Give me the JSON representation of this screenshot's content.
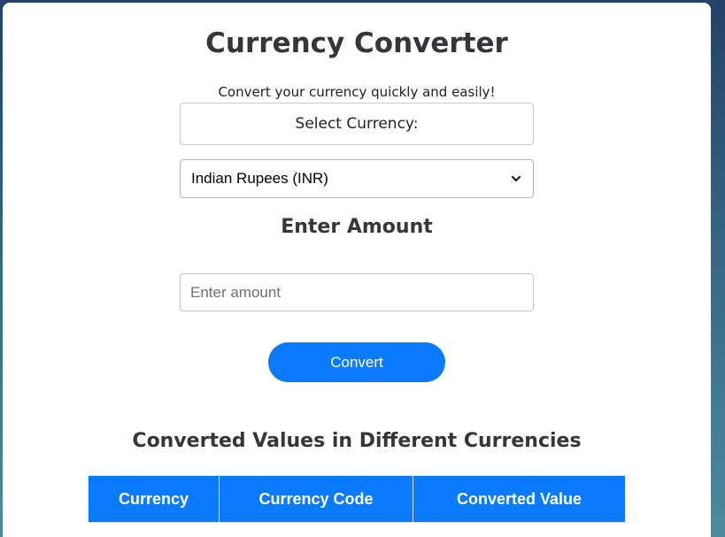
{
  "app": {
    "title": "Currency Converter",
    "subtitle": "Convert your currency quickly and easily!"
  },
  "form": {
    "select_label": "Select Currency:",
    "currency_select": {
      "selected": "Indian Rupees (INR)",
      "icon": "chevron-down-icon"
    },
    "amount_heading": "Enter Amount",
    "amount_input": {
      "value": "",
      "placeholder": "Enter amount"
    },
    "convert_label": "Convert"
  },
  "results": {
    "heading": "Converted Values in Different Currencies",
    "columns": [
      "Currency",
      "Currency Code",
      "Converted Value"
    ],
    "rows": []
  },
  "colors": {
    "accent": "#0a7bff",
    "heading_text": "#33373d",
    "card_bg": "#ffffff"
  }
}
